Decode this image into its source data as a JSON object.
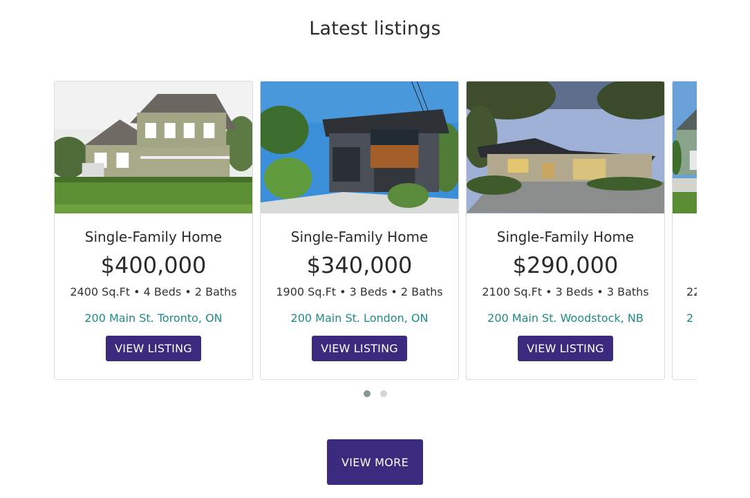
{
  "section": {
    "title": "Latest listings"
  },
  "listings": [
    {
      "type": "Single-Family Home",
      "price": "$400,000",
      "specs": "2400 Sq.Ft • 4 Beds • 2 Baths",
      "address": "200 Main St. Toronto, ON",
      "button": "VIEW LISTING",
      "image": "house-photo-suburban"
    },
    {
      "type": "Single-Family Home",
      "price": "$340,000",
      "specs": "1900 Sq.Ft • 3 Beds • 2 Baths",
      "address": "200 Main St. London, ON",
      "button": "VIEW LISTING",
      "image": "house-photo-modern"
    },
    {
      "type": "Single-Family Home",
      "price": "$290,000",
      "specs": "2100 Sq.Ft • 3 Beds • 3 Baths",
      "address": "200 Main St. Woodstock, NB",
      "button": "VIEW LISTING",
      "image": "house-photo-ranch"
    },
    {
      "type": "",
      "price": "",
      "specs": "22",
      "address": "2",
      "button": "",
      "image": "house-photo-partial"
    }
  ],
  "pagination": {
    "pages": 2,
    "active": 1
  },
  "view_more": {
    "label": "VIEW MORE"
  },
  "colors": {
    "accent": "#3b2a7d",
    "address": "#1f8a85",
    "dot_active": "#869791",
    "dot_inactive": "#d6d6d6"
  }
}
